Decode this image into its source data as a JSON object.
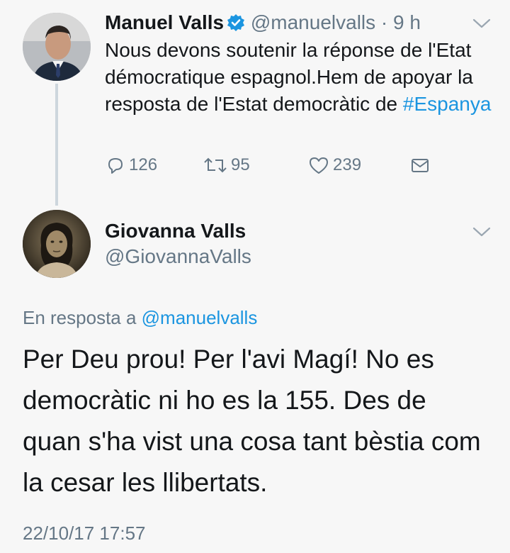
{
  "tweet1": {
    "name": "Manuel Valls",
    "handle": "@manuelvalls",
    "time": "· 9 h",
    "text_plain": "Nous devons soutenir la réponse de l'Etat démocratique espagnol.Hem de apoyar la resposta de l'Estat democràtic de ",
    "hashtag": "#Espanya",
    "reply_count": "126",
    "retweet_count": "95",
    "like_count": "239",
    "accent_color": "#1b95e0"
  },
  "tweet2": {
    "name": "Giovanna Valls",
    "handle": "@GiovannaValls",
    "reply_prefix": "En resposta a ",
    "reply_mention": "@manuelvalls",
    "text": "Per Deu prou! Per l'avi Magí! No es democràtic ni ho es la 155. Des de quan s'ha vist una cosa tant bèstia com la cesar les llibertats.",
    "timestamp": "22/10/17 17:57"
  },
  "icons": [
    "verified-badge-icon",
    "chevron-down-icon",
    "reply-icon",
    "retweet-icon",
    "like-icon",
    "direct-message-icon"
  ]
}
